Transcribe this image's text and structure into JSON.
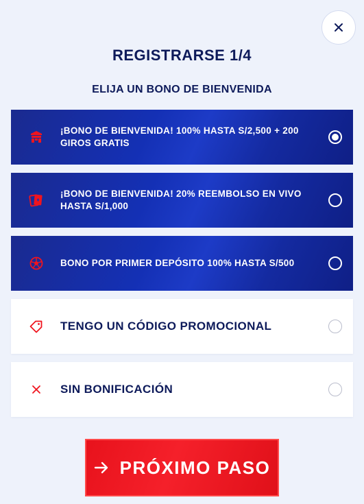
{
  "header": {
    "title": "REGISTRARSE 1/4",
    "subtitle": "ELIJA UN BONO DE BIENVENIDA",
    "close_icon": "close-icon"
  },
  "options": [
    {
      "label": "¡BONO DE BIENVENIDA! 100% HASTA S/2,500 + 200 GIROS GRATIS",
      "icon": "casino-icon",
      "selected": true,
      "style": "dark"
    },
    {
      "label": "¡BONO DE BIENVENIDA! 20% REEMBOLSO EN VIVO HASTA S/1,000",
      "icon": "cards-icon",
      "selected": false,
      "style": "dark"
    },
    {
      "label": "BONO POR PRIMER DEPÓSITO 100% HASTA S/500",
      "icon": "soccer-ball-icon",
      "selected": false,
      "style": "dark"
    },
    {
      "label": "TENGO UN CÓDIGO PROMOCIONAL",
      "icon": "tag-icon",
      "selected": false,
      "style": "light"
    },
    {
      "label": "SIN BONIFICACIÓN",
      "icon": "x-icon",
      "selected": false,
      "style": "light"
    }
  ],
  "next_button": {
    "label": "PRÓXIMO PASO",
    "icon": "arrow-right-icon"
  },
  "colors": {
    "accent_red": "#f0141e",
    "navy": "#0d1a5a",
    "option_blue": "#1430b5",
    "background": "#eef2fb"
  }
}
